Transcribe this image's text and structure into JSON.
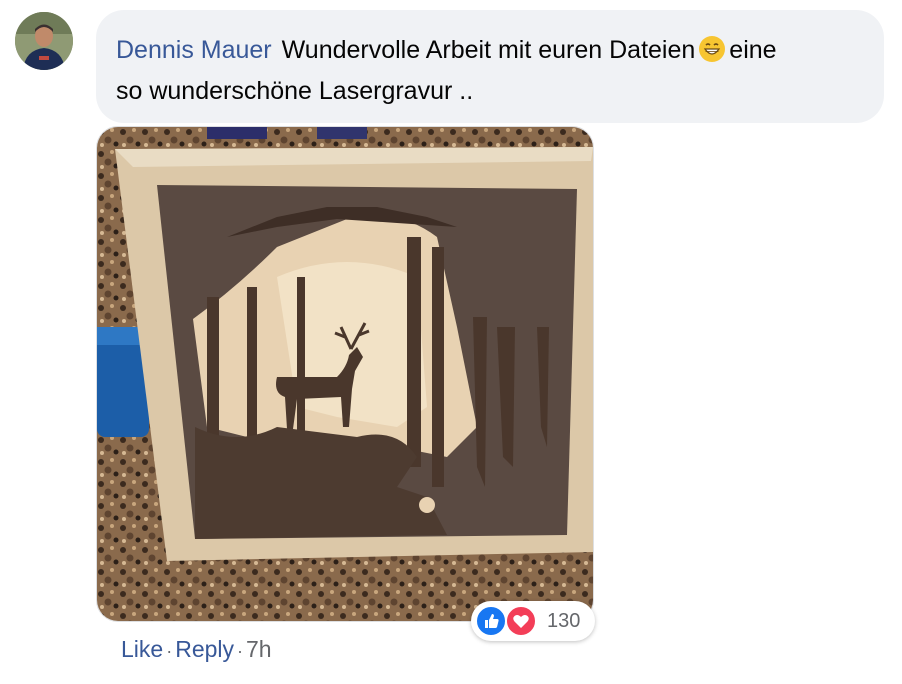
{
  "comment": {
    "author": "Dennis Mauer",
    "text_line1": "Wundervolle Arbeit mit euren Dateien",
    "text_line1_after_emoji": "eine",
    "text_line2": "so wunderschöne Lasergravur ..",
    "emoji": "grinning-face-icon"
  },
  "reactions": {
    "icons": [
      "like-icon",
      "love-icon"
    ],
    "count": "130"
  },
  "actions": {
    "like": "Like",
    "reply": "Reply",
    "separator": "·",
    "time": "7h"
  },
  "colors": {
    "link": "#385898",
    "bubble": "#f0f2f5",
    "meta": "#65676b",
    "like_blue": "#1877f2",
    "love_red": "#f33e58"
  }
}
